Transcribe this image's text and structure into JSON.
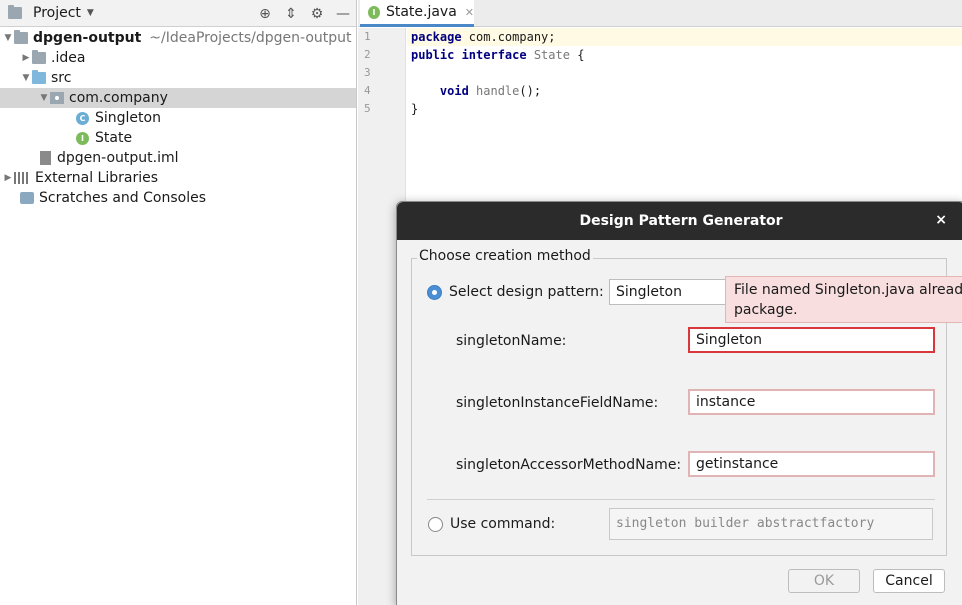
{
  "project": {
    "title": "Project",
    "root": {
      "name": "dpgen-output",
      "path": "~/IdeaProjects/dpgen-output"
    },
    "items": [
      {
        "label": ".idea"
      },
      {
        "label": "src"
      },
      {
        "label": "com.company"
      },
      {
        "label": "Singleton",
        "badge": "C"
      },
      {
        "label": "State",
        "badge": "I"
      },
      {
        "label": "dpgen-output.iml"
      },
      {
        "label": "External Libraries"
      },
      {
        "label": "Scratches and Consoles"
      }
    ]
  },
  "editor": {
    "tab_label": "State.java",
    "tab_badge": "I",
    "line_numbers": [
      "1",
      "2",
      "3",
      "4",
      "5"
    ],
    "code": {
      "l1_kw": "package",
      "l1_rest": " com.company;",
      "l2_kw1": "public",
      "l2_kw2": " interface",
      "l2_name": " State",
      "l2_rest": " {",
      "l4_indent": "    ",
      "l4_kw": "void",
      "l4_name": " handle",
      "l4_rest": "();",
      "l5": "}"
    }
  },
  "dialog": {
    "title": "Design Pattern Generator",
    "close": "×",
    "group_label": "Choose creation method",
    "select_label": "Select design pattern:",
    "select_value": "Singleton",
    "fields": [
      {
        "label": "singletonName:",
        "value": "Singleton"
      },
      {
        "label": "singletonInstanceFieldName:",
        "value": "instance"
      },
      {
        "label": "singletonAccessorMethodName:",
        "value": "getinstance"
      }
    ],
    "command_label": "Use command:",
    "command_value": "singleton builder abstractfactory",
    "ok": "OK",
    "cancel": "Cancel",
    "tooltip_line1": "File named Singleton.java already",
    "tooltip_line2": "package."
  },
  "colors": {
    "error_border": "#d9363e",
    "tooltip_bg": "#f8dede",
    "selection": "#d5d5d5",
    "accent": "#4a8fd6"
  }
}
